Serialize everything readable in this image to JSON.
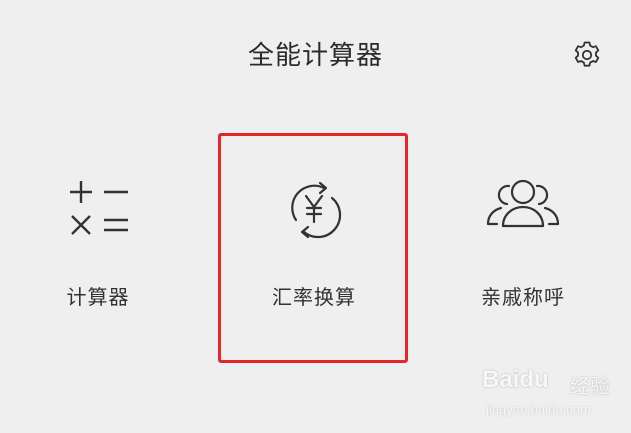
{
  "header": {
    "title": "全能计算器",
    "settings_icon": "gear-icon"
  },
  "tiles": [
    {
      "label": "计算器",
      "icon": "calculator-icon"
    },
    {
      "label": "汇率换算",
      "icon": "currency-exchange-icon"
    },
    {
      "label": "亲戚称呼",
      "icon": "relatives-icon"
    }
  ],
  "highlight": {
    "color": "#e8262a",
    "target": "汇率换算"
  },
  "watermark": {
    "brand": "Baidu",
    "text": "经验",
    "url": "jingyan.baidu.com"
  }
}
